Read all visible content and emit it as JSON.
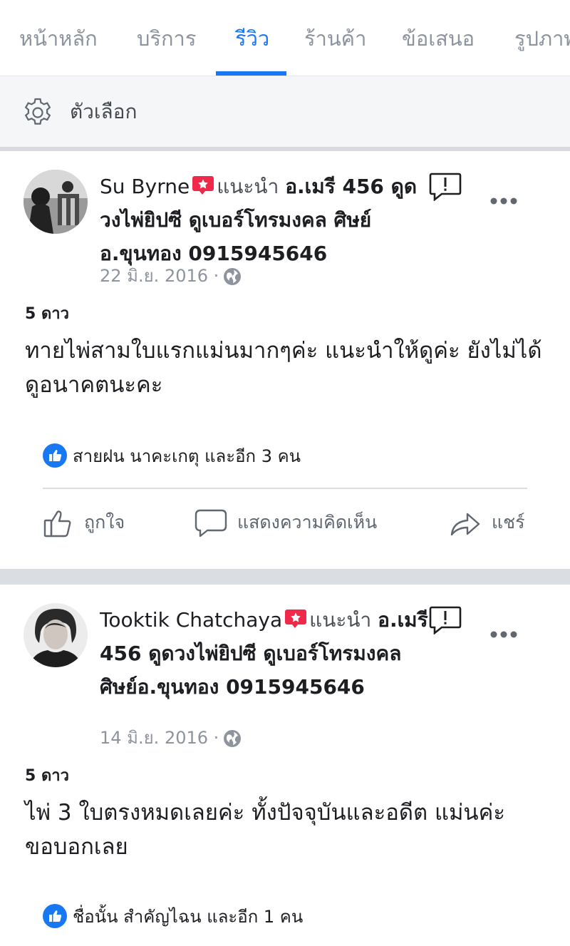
{
  "tabs": [
    {
      "label": "หน้าหลัก"
    },
    {
      "label": "บริการ"
    },
    {
      "label": "รีวิว"
    },
    {
      "label": "ร้านค้า"
    },
    {
      "label": "ข้อเสนอ"
    },
    {
      "label": "รูปภาพ"
    }
  ],
  "active_tab": "รีวิว",
  "options": {
    "label": "ตัวเลือก"
  },
  "posts": [
    {
      "author": "Su Byrne",
      "recommends": "แนะนำ",
      "page_name": "อ.เมรี 456 ดูดวงไพ่ยิปซี ดูเบอร์โทรมงคล ศิษย์อ.ขุนทอง 0915945646",
      "date": "22 มิ.ย. 2016",
      "dot": "·",
      "stars": "5 ดาว",
      "text": "ทายไพ่สามใบแรกแม่นมากๆค่ะ แนะนำให้ดูค่ะ ยังไม่ได้ดูอนาคตนะคะ",
      "likes": "สายฝน นาคะเกตุ และอีก 3 คน",
      "actions": {
        "like": "ถูกใจ",
        "comment": "แสดงความคิดเห็น",
        "share": "แชร์"
      }
    },
    {
      "author": "Tooktik Chatchaya",
      "recommends": "แนะนำ",
      "page_name": "อ.เมรี 456 ดูดวงไพ่ยิปซี ดูเบอร์โทรมงคล ศิษย์อ.ขุนทอง 0915945646",
      "date": "14 มิ.ย. 2016",
      "dot": "·",
      "stars": "5 ดาว",
      "text": "ไพ่ 3 ใบตรงหมดเลยค่ะ ทั้งปัจจุบันและอดีต แม่นค่ะขอบอกเลย",
      "likes": "ชื่อนั้น สำคัญไฉน และอีก 1 คน"
    }
  ],
  "colors": {
    "accent": "#1877f2",
    "recommend_badge": "#f02849",
    "muted": "#8d949e"
  },
  "icons": [
    "gear-icon",
    "recommend-icon",
    "report-icon",
    "more-icon",
    "globe-icon",
    "like-badge-icon",
    "like-icon",
    "comment-icon",
    "share-icon"
  ]
}
